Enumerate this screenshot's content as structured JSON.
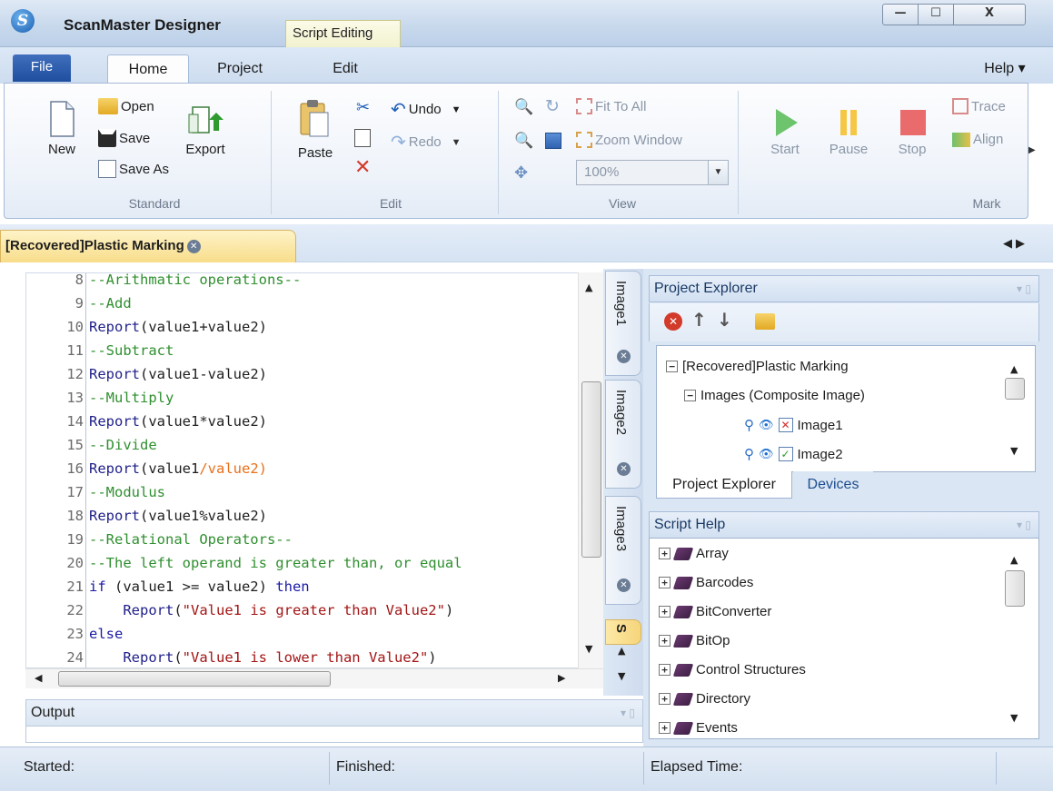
{
  "window": {
    "title": "ScanMaster Designer",
    "context_tab": "Script Editing",
    "minimize": "—",
    "maximize": "☐",
    "close": "X"
  },
  "ribbon_tabs": {
    "file": "File",
    "home": "Home",
    "project": "Project",
    "edit": "Edit",
    "help": "Help ▾"
  },
  "standard": {
    "new": "New",
    "open": "Open",
    "save": "Save",
    "save_as": "Save As",
    "export": "Export",
    "group": "Standard"
  },
  "edit_group": {
    "paste": "Paste",
    "undo": "Undo",
    "redo": "Redo",
    "group": "Edit"
  },
  "view": {
    "fit_to_all": "Fit To All",
    "zoom_window": "Zoom Window",
    "zoom_value": "100%",
    "group": "View"
  },
  "mark": {
    "start": "Start",
    "pause": "Pause",
    "stop": "Stop",
    "trace": "Trace",
    "align": "Align",
    "group": "Mark"
  },
  "document_tab": {
    "title": "[Recovered]Plastic Marking"
  },
  "code_lines": [
    {
      "n": "8",
      "segments": [
        {
          "t": "--Arithmatic operations--",
          "c": "cmt"
        }
      ]
    },
    {
      "n": "9",
      "segments": [
        {
          "t": "--Add",
          "c": "cmt"
        }
      ]
    },
    {
      "n": "10",
      "segments": [
        {
          "t": "Report",
          "c": "fn"
        },
        {
          "t": "(value1+value2)",
          "c": ""
        }
      ]
    },
    {
      "n": "11",
      "segments": [
        {
          "t": "--Subtract",
          "c": "cmt"
        }
      ]
    },
    {
      "n": "12",
      "segments": [
        {
          "t": "Report",
          "c": "fn"
        },
        {
          "t": "(value1-value2)",
          "c": ""
        }
      ]
    },
    {
      "n": "13",
      "segments": [
        {
          "t": "--Multiply",
          "c": "cmt"
        }
      ]
    },
    {
      "n": "14",
      "segments": [
        {
          "t": "Report",
          "c": "fn"
        },
        {
          "t": "(value1*value2)",
          "c": ""
        }
      ]
    },
    {
      "n": "15",
      "segments": [
        {
          "t": "--Divide",
          "c": "cmt"
        }
      ]
    },
    {
      "n": "16",
      "segments": [
        {
          "t": "Report",
          "c": "fn"
        },
        {
          "t": "(value1",
          "c": ""
        },
        {
          "t": "/value2)",
          "c": "hl"
        }
      ]
    },
    {
      "n": "17",
      "segments": [
        {
          "t": "--Modulus",
          "c": "cmt"
        }
      ]
    },
    {
      "n": "18",
      "segments": [
        {
          "t": "Report",
          "c": "fn"
        },
        {
          "t": "(value1%value2)",
          "c": ""
        }
      ]
    },
    {
      "n": "19",
      "segments": [
        {
          "t": "--Relational Operators--",
          "c": "cmt"
        }
      ]
    },
    {
      "n": "20",
      "segments": [
        {
          "t": "--The left operand is greater than, or equal",
          "c": "cmt"
        }
      ]
    },
    {
      "n": "21",
      "segments": [
        {
          "t": "if",
          "c": "kw"
        },
        {
          "t": " (value1 >= value2) ",
          "c": ""
        },
        {
          "t": "then",
          "c": "kw"
        }
      ]
    },
    {
      "n": "22",
      "segments": [
        {
          "t": "    ",
          "c": ""
        },
        {
          "t": "Report",
          "c": "fn"
        },
        {
          "t": "(",
          "c": ""
        },
        {
          "t": "\"Value1 is greater than Value2\"",
          "c": "str"
        },
        {
          "t": ")",
          "c": ""
        }
      ]
    },
    {
      "n": "23",
      "segments": [
        {
          "t": "else",
          "c": "kw"
        }
      ]
    },
    {
      "n": "24",
      "segments": [
        {
          "t": "    ",
          "c": ""
        },
        {
          "t": "Report",
          "c": "fn"
        },
        {
          "t": "(",
          "c": ""
        },
        {
          "t": "\"Value1 is lower than Value2\"",
          "c": "str"
        },
        {
          "t": ")",
          "c": ""
        }
      ]
    }
  ],
  "image_tabs": [
    "Image1",
    "Image2",
    "Image3",
    "S"
  ],
  "output": {
    "title": "Output"
  },
  "project_explorer": {
    "title": "Project Explorer",
    "tree": [
      {
        "label": "[Recovered]Plastic Marking",
        "level": 0,
        "expand": "−"
      },
      {
        "label": "Images (Composite Image)",
        "level": 1,
        "expand": "−"
      },
      {
        "label": "Image1",
        "level": 2,
        "state": "excluded"
      },
      {
        "label": "Image2",
        "level": 2,
        "state": "included"
      }
    ],
    "tabs": {
      "explorer": "Project Explorer",
      "devices": "Devices"
    }
  },
  "script_help": {
    "title": "Script Help",
    "items": [
      "Array",
      "Barcodes",
      "BitConverter",
      "BitOp",
      "Control Structures",
      "Directory",
      "Events"
    ]
  },
  "status": {
    "started": "Started:",
    "finished": "Finished:",
    "elapsed": "Elapsed Time:"
  },
  "colors": {
    "accent": "#1f4e9f",
    "doc_tab": "#f8dd8a",
    "play": "#4caf50",
    "pause": "#f4b400",
    "stop": "#e05050"
  }
}
